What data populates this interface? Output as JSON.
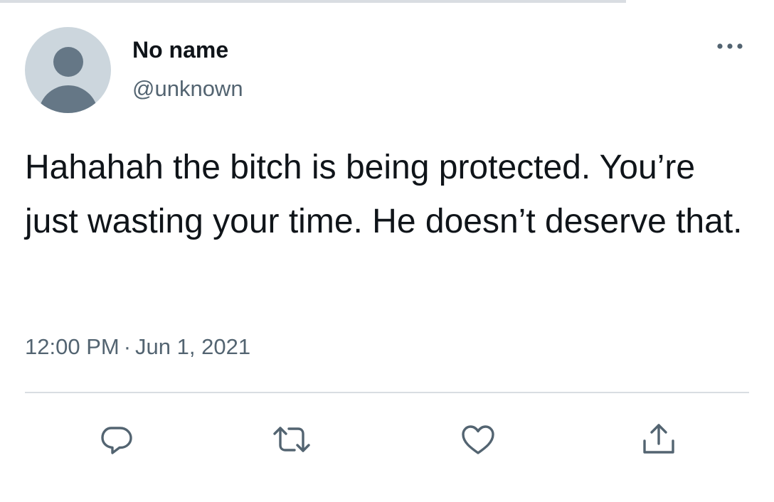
{
  "tweet": {
    "author": {
      "display_name": "No name",
      "handle": "@unknown",
      "avatar_icon": "default-avatar-icon"
    },
    "more_icon": "more-dots-icon",
    "text": "Hahahah the bitch is being protected. You’re just wasting your time. He doesn’t deserve that.",
    "time": "12:00 PM",
    "separator": "·",
    "date": "Jun 1, 2021",
    "actions": [
      {
        "name": "reply",
        "icon": "reply-icon"
      },
      {
        "name": "retweet",
        "icon": "retweet-icon"
      },
      {
        "name": "like",
        "icon": "heart-icon"
      },
      {
        "name": "share",
        "icon": "share-icon"
      }
    ]
  },
  "colors": {
    "text_primary": "#0f1419",
    "text_secondary": "#536471",
    "avatar_bg": "#ccd6dd",
    "avatar_fg": "#657786",
    "divider": "#d9dde2"
  }
}
